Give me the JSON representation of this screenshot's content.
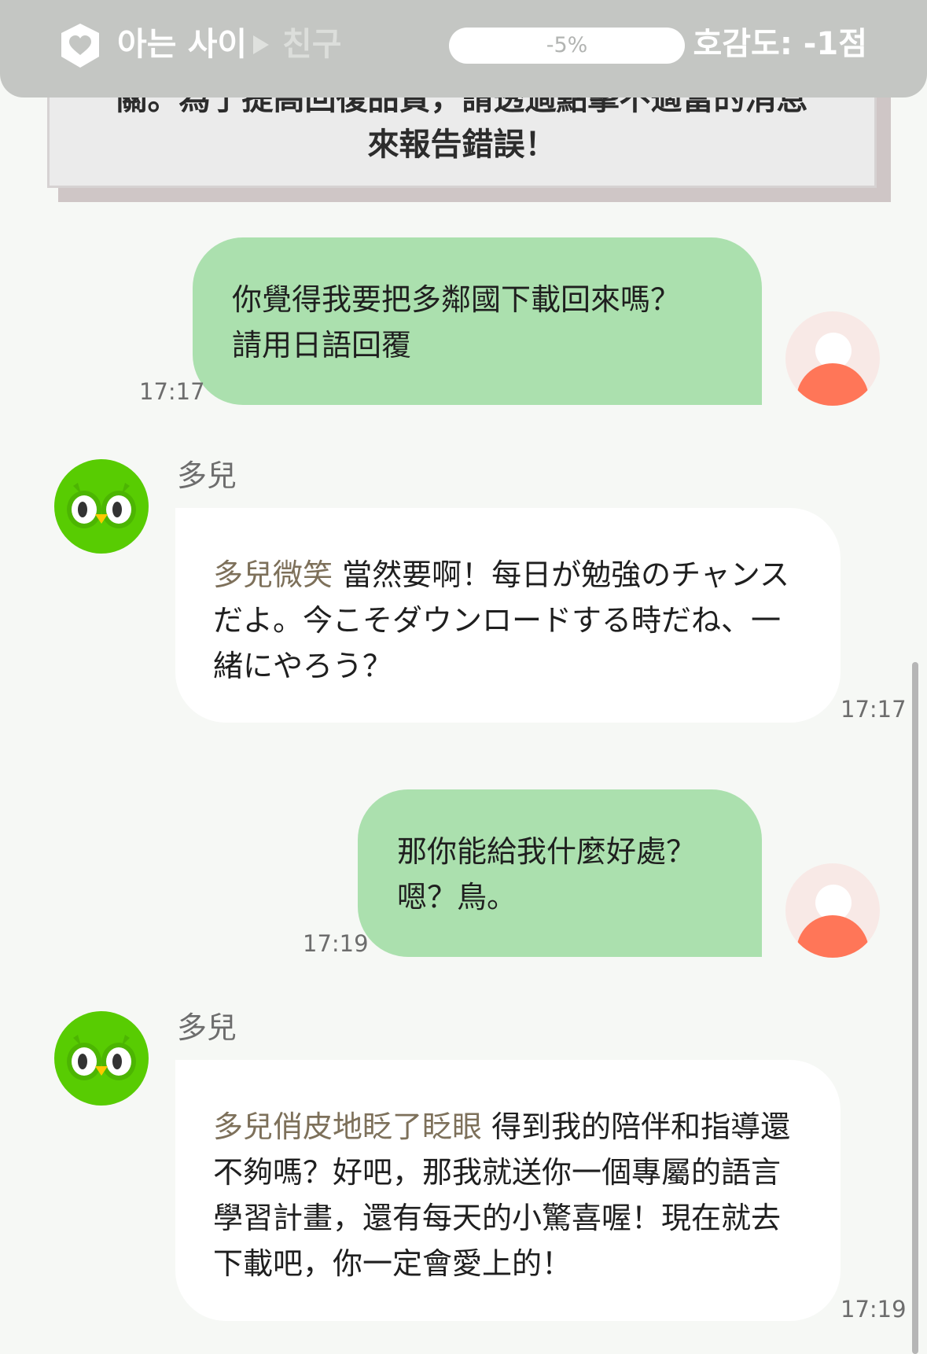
{
  "header": {
    "relationship_current": "아는 사이",
    "relationship_next": "친구",
    "progress_label": "-5%",
    "progress_value": -0.05,
    "score_label": "호감도: -1점",
    "icons": {
      "shield": "heart-shield-icon",
      "arrow": "play-arrow-icon"
    },
    "colors": {
      "bar": "#c4c6c3",
      "progress_track": "#ffffff"
    }
  },
  "notice": {
    "line1": "關。為了提高回復品質，請透過點擊不適當的消息",
    "line2": "來報告錯誤！"
  },
  "messages": [
    {
      "role": "user",
      "text": "你覺得我要把多鄰國下載回來嗎？\n請用日語回覆",
      "time": "17:17"
    },
    {
      "role": "bot",
      "sender": "多兒",
      "action": "多兒微笑",
      "text": " 當然要啊！每日が勉強のチャンスだよ。今こそダウンロードする時だね、一緒にやろう？",
      "time": "17:17"
    },
    {
      "role": "user",
      "text": "那你能給我什麼好處？\n嗯？鳥。",
      "time": "17:19"
    },
    {
      "role": "bot",
      "sender": "多兒",
      "action": "多兒俏皮地眨了眨眼",
      "text": " 得到我的陪伴和指導還不夠嗎？好吧，那我就送你一個專屬的語言學習計畫，還有每天的小驚喜喔！現在就去下載吧，你一定會愛上的！",
      "time": "17:19"
    }
  ],
  "colors": {
    "user_bubble": "#abe0ae",
    "bot_bubble": "#ffffff",
    "action_text": "#7d705a",
    "user_avatar_body": "#ff7658",
    "bot_avatar": "#58cc02"
  }
}
